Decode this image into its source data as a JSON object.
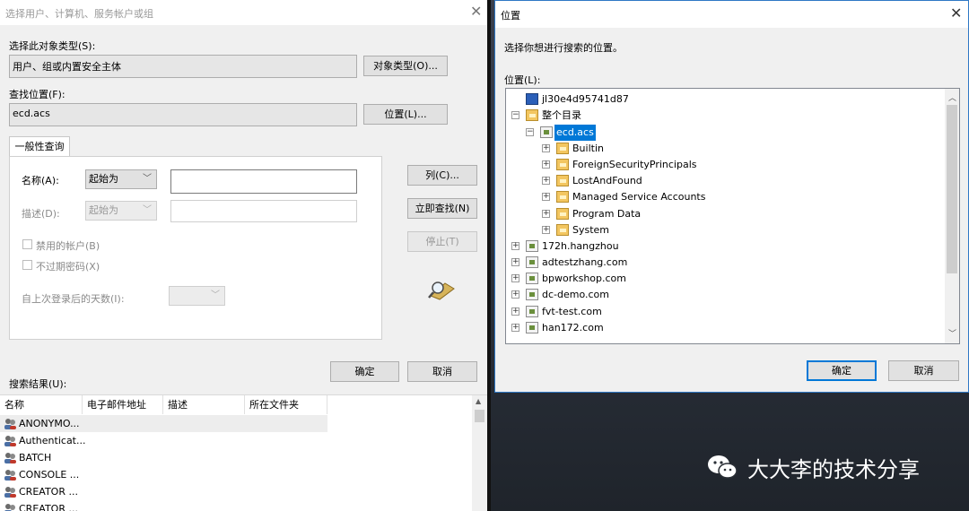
{
  "left_dialog": {
    "title": "选择用户、计算机、服务帐户或组",
    "object_type_label": "选择此对象类型(S):",
    "object_type_value": "用户、组或内置安全主体",
    "object_type_button": "对象类型(O)...",
    "location_label": "查找位置(F):",
    "location_value": "ecd.acs",
    "location_button": "位置(L)...",
    "tab_label": "一般性查询",
    "name_label": "名称(A):",
    "name_select": "起始为",
    "desc_label": "描述(D):",
    "desc_select": "起始为",
    "disabled_accounts": "禁用的帐户(B)",
    "non_expiring_pw": "不过期密码(X)",
    "days_since_logon": "自上次登录后的天数(I):",
    "columns_button": "列(C)...",
    "find_now_button": "立即查找(N)",
    "stop_button": "停止(T)",
    "ok_button": "确定",
    "cancel_button": "取消",
    "results_label": "搜索结果(U):",
    "results_columns": [
      "名称",
      "电子邮件地址",
      "描述",
      "所在文件夹"
    ],
    "results_rows": [
      "ANONYMO...",
      "Authenticat...",
      "BATCH",
      "CONSOLE ...",
      "CREATOR ...",
      "CREATOR ..."
    ]
  },
  "right_dialog": {
    "title": "位置",
    "prompt": "选择你想进行搜索的位置。",
    "location_label": "位置(L):",
    "tree": {
      "computer": "jl30e4d95741d87",
      "entire_directory": "整个目录",
      "selected_domain": "ecd.acs",
      "children": [
        "Builtin",
        "ForeignSecurityPrincipals",
        "LostAndFound",
        "Managed Service Accounts",
        "Program Data",
        "System"
      ],
      "other_domains": [
        "172h.hangzhou",
        "adtestzhang.com",
        "bpworkshop.com",
        "dc-demo.com",
        "fvt-test.com",
        "han172.com"
      ]
    },
    "ok_button": "确定",
    "cancel_button": "取消"
  },
  "watermark": "大大李的技术分享",
  "icons": {
    "close": "close-icon",
    "dropdown": "chevron-down-icon",
    "search": "search-flashlight-icon",
    "user_group": "user-group-icon",
    "folder": "folder-icon",
    "domain": "domain-icon",
    "computer": "computer-icon",
    "wechat": "wechat-icon"
  },
  "colors": {
    "selection": "#0078d7",
    "dialog_bg": "#f0f0f0",
    "right_border": "#2f78c5"
  }
}
